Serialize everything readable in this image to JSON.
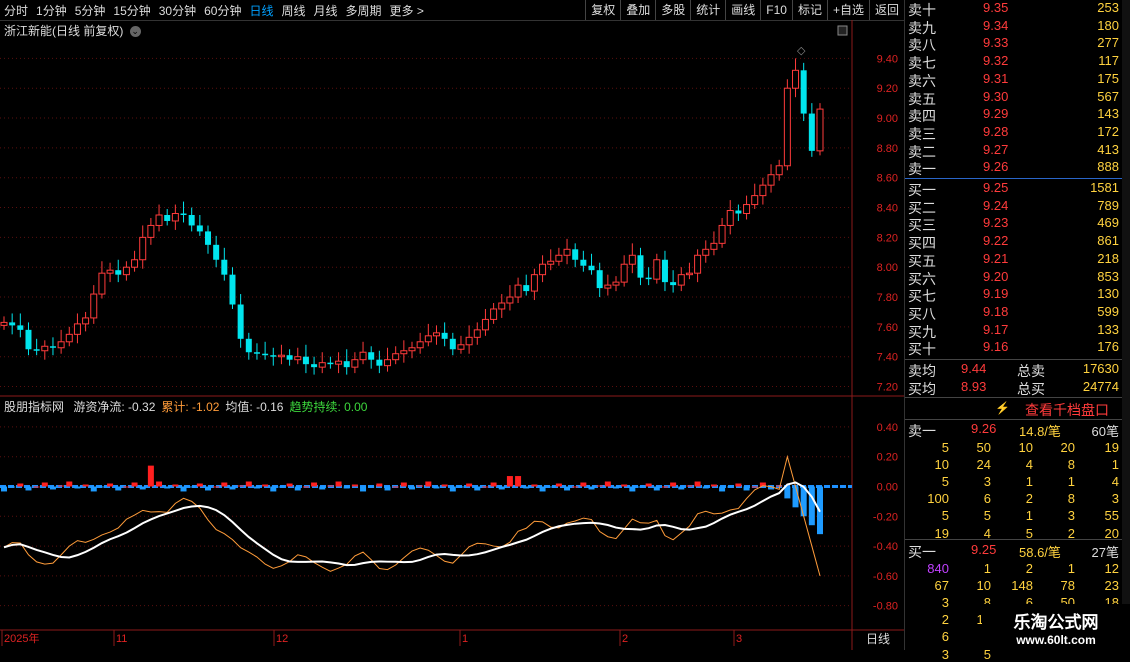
{
  "toolbar": {
    "periods": [
      "分时",
      "1分钟",
      "5分钟",
      "15分钟",
      "30分钟",
      "60分钟",
      "日线",
      "周线",
      "月线",
      "多周期",
      "更多 >"
    ],
    "active_period": "日线",
    "right_buttons": [
      "复权",
      "叠加",
      "多股",
      "统计",
      "画线",
      "F10",
      "标记",
      "+自选",
      "返回"
    ]
  },
  "chart": {
    "title": "浙江新能(日线 前复权)",
    "y_ticks": [
      "9.40",
      "9.20",
      "9.00",
      "8.80",
      "8.60",
      "8.40",
      "8.20",
      "8.00",
      "7.80",
      "7.60",
      "7.40",
      "7.20"
    ],
    "x_labels": [
      "2025年",
      "11",
      "12",
      "1",
      "2",
      "3"
    ],
    "period_label": "日线"
  },
  "indicator": {
    "name": "股朋指标网",
    "items": [
      {
        "label": "游资净流: -0.32",
        "color": "#dddddd"
      },
      {
        "label": "累计: -1.02",
        "color": "#ff9c3a"
      },
      {
        "label": "均值: -0.16",
        "color": "#dddddd"
      },
      {
        "label": "趋势持续: 0.00",
        "color": "#3cd63c"
      }
    ],
    "y_ticks": [
      "0.40",
      "0.20",
      "0.00",
      "-0.20",
      "-0.40",
      "-0.60",
      "-0.80"
    ]
  },
  "orderbook": {
    "sells": [
      {
        "label": "卖十",
        "price": "9.35",
        "vol": "253"
      },
      {
        "label": "卖九",
        "price": "9.34",
        "vol": "180"
      },
      {
        "label": "卖八",
        "price": "9.33",
        "vol": "277"
      },
      {
        "label": "卖七",
        "price": "9.32",
        "vol": "117"
      },
      {
        "label": "卖六",
        "price": "9.31",
        "vol": "175"
      },
      {
        "label": "卖五",
        "price": "9.30",
        "vol": "567"
      },
      {
        "label": "卖四",
        "price": "9.29",
        "vol": "143"
      },
      {
        "label": "卖三",
        "price": "9.28",
        "vol": "172"
      },
      {
        "label": "卖二",
        "price": "9.27",
        "vol": "413"
      },
      {
        "label": "卖一",
        "price": "9.26",
        "vol": "888"
      }
    ],
    "buys": [
      {
        "label": "买一",
        "price": "9.25",
        "vol": "1581"
      },
      {
        "label": "买二",
        "price": "9.24",
        "vol": "789"
      },
      {
        "label": "买三",
        "price": "9.23",
        "vol": "469"
      },
      {
        "label": "买四",
        "price": "9.22",
        "vol": "861"
      },
      {
        "label": "买五",
        "price": "9.21",
        "vol": "218"
      },
      {
        "label": "买六",
        "price": "9.20",
        "vol": "853"
      },
      {
        "label": "买七",
        "price": "9.19",
        "vol": "130"
      },
      {
        "label": "买八",
        "price": "9.18",
        "vol": "599"
      },
      {
        "label": "买九",
        "price": "9.17",
        "vol": "133"
      },
      {
        "label": "买十",
        "price": "9.16",
        "vol": "176"
      }
    ],
    "avg_sell": {
      "label": "卖均",
      "price": "9.44",
      "total_label": "总卖",
      "total": "17630"
    },
    "avg_buy": {
      "label": "买均",
      "price": "8.93",
      "total_label": "总买",
      "total": "24774"
    },
    "depth_button": "查看千档盘口"
  },
  "ticks": {
    "sell1": {
      "label": "卖一",
      "price": "9.26",
      "avg": "14.8/笔",
      "count": "60笔"
    },
    "sell_rows": [
      [
        "5",
        "50",
        "10",
        "20",
        "19"
      ],
      [
        "10",
        "24",
        "4",
        "8",
        "1"
      ],
      [
        "5",
        "3",
        "1",
        "1",
        "4"
      ],
      [
        "100",
        "6",
        "2",
        "8",
        "3"
      ],
      [
        "5",
        "5",
        "1",
        "3",
        "55"
      ],
      [
        "19",
        "4",
        "5",
        "2",
        "20"
      ]
    ],
    "buy1": {
      "label": "买一",
      "price": "9.25",
      "avg": "58.6/笔",
      "count": "27笔"
    },
    "buy_rows": [
      [
        "840",
        "1",
        "2",
        "1",
        "12"
      ],
      [
        "67",
        "10",
        "148",
        "78",
        "23"
      ],
      [
        "3",
        "8",
        "6",
        "50",
        "18"
      ],
      [
        "2",
        "10",
        "",
        "",
        ""
      ],
      [
        "6",
        "",
        "",
        "",
        ""
      ],
      [
        "3",
        "5",
        "",
        "",
        ""
      ]
    ]
  },
  "watermark": {
    "title": "乐淘公式网",
    "url": "www.60lt.com"
  },
  "colors": {
    "up": "#ff3b3b",
    "down": "#00e5ee",
    "accent": "#2a66c9"
  }
}
